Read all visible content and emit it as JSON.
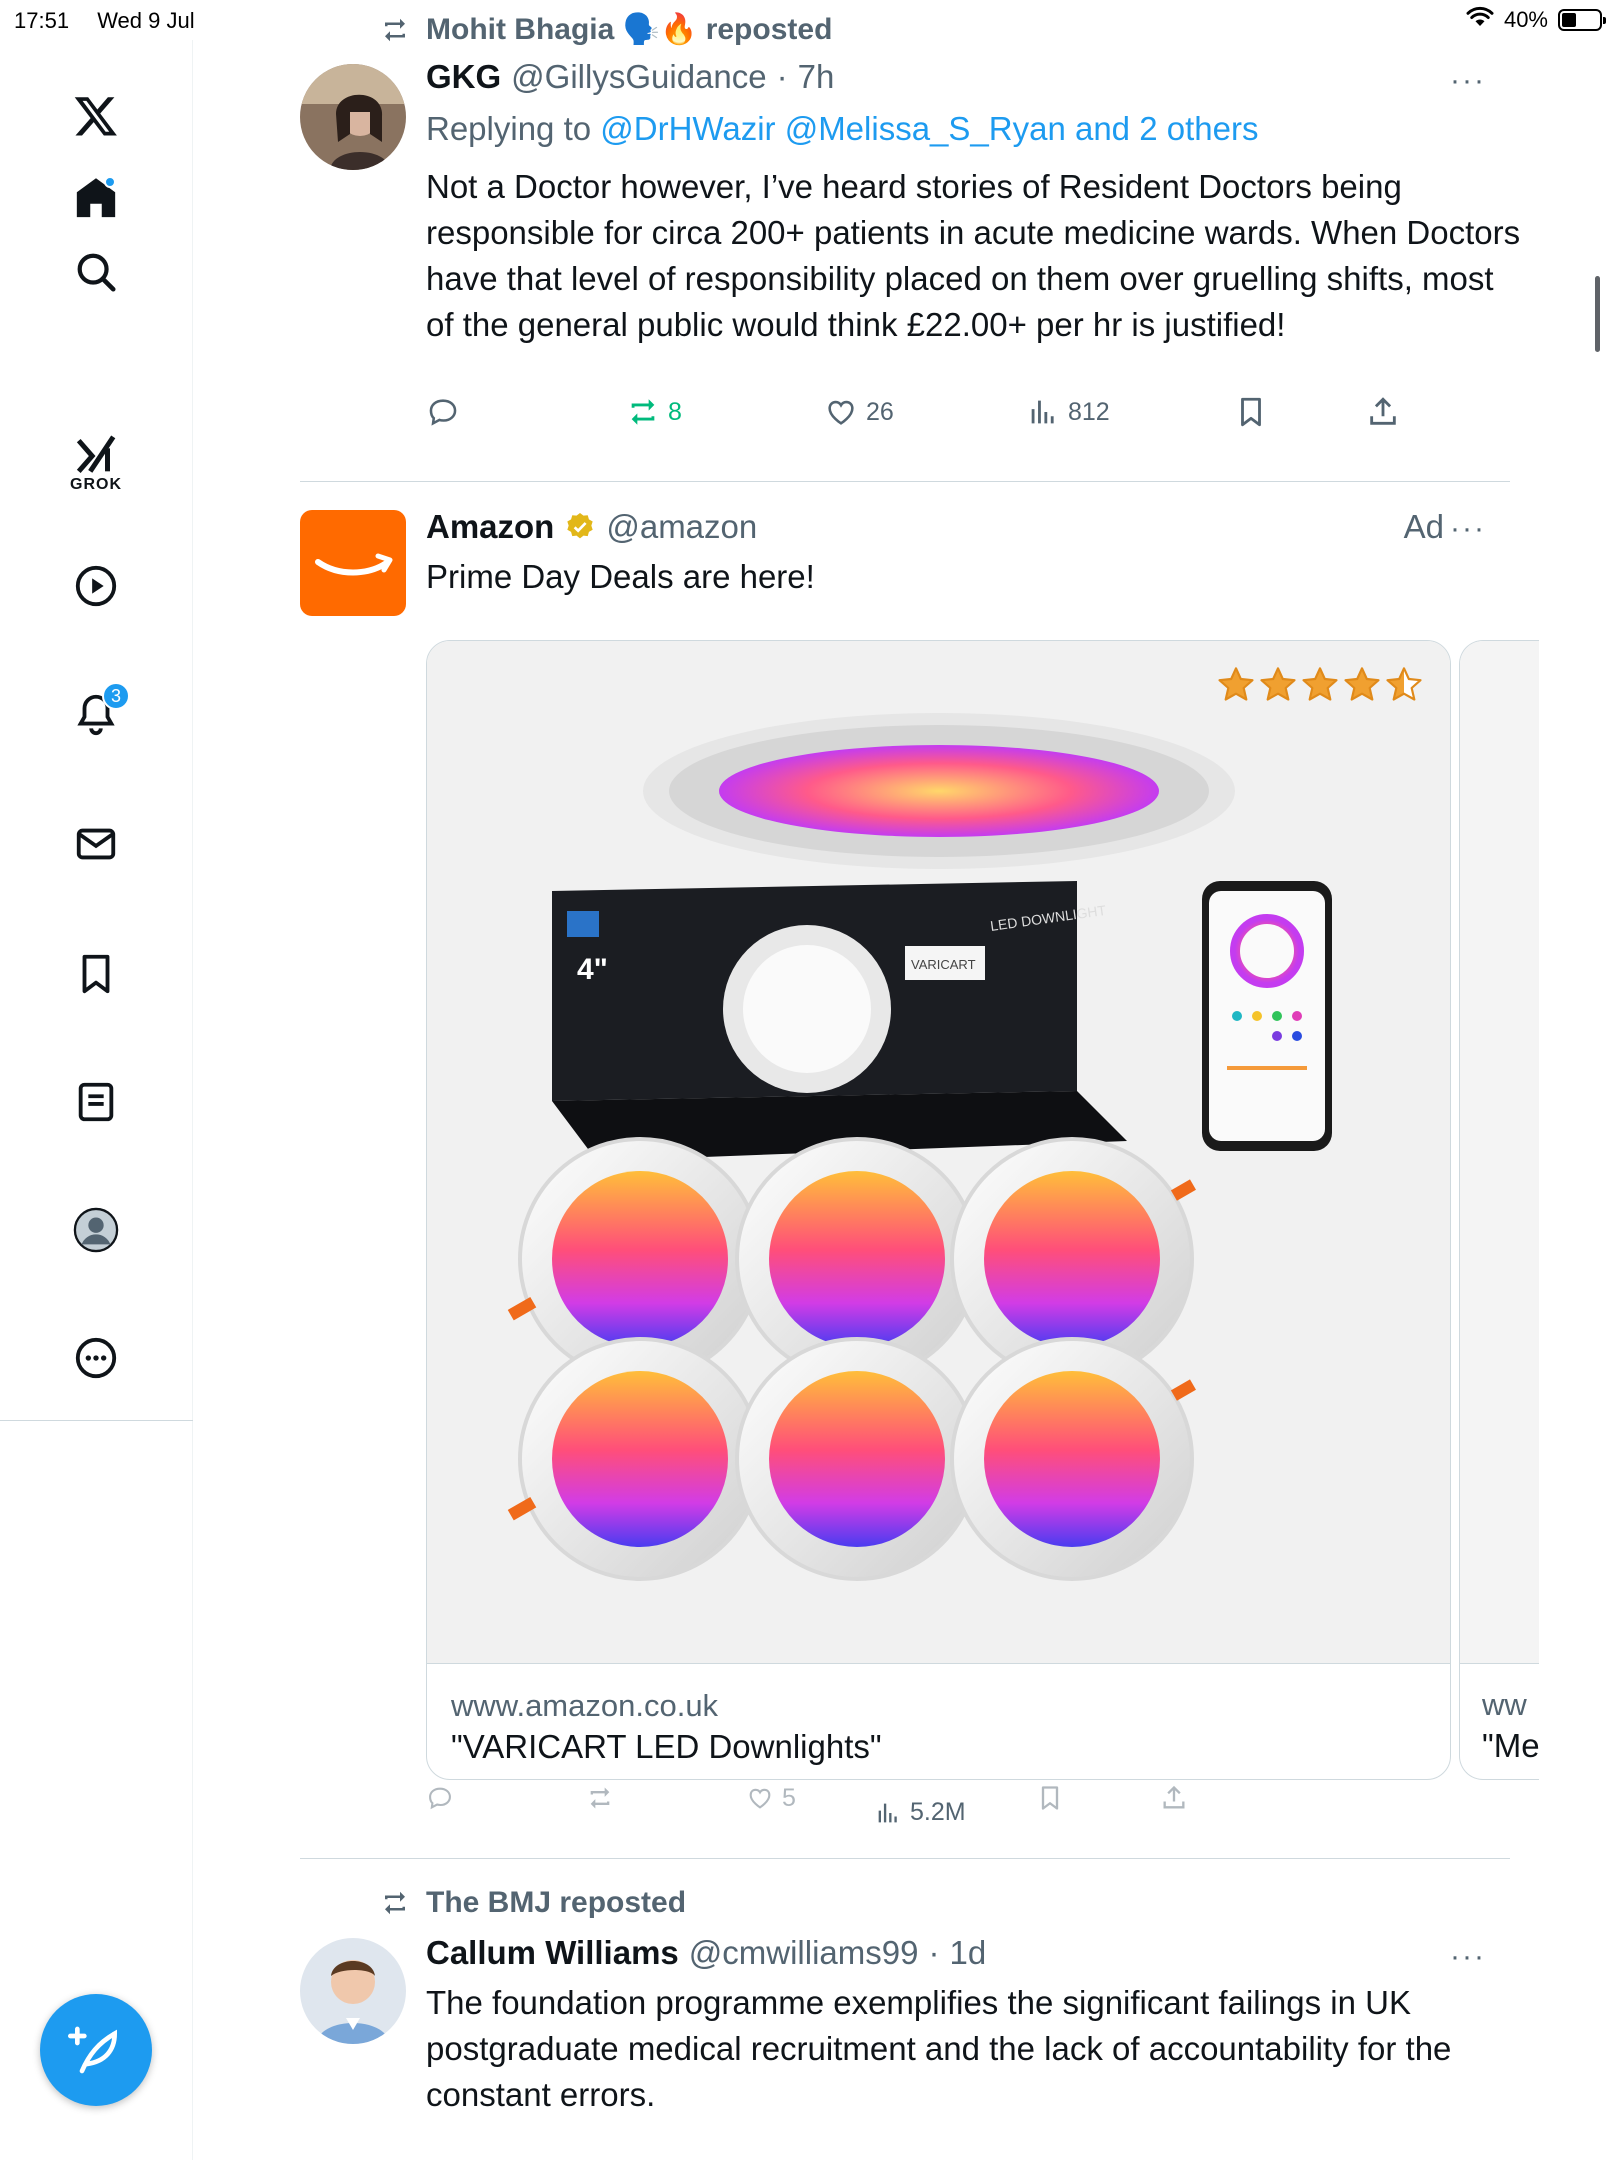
{
  "status_bar": {
    "time": "17:51",
    "date": "Wed 9 Jul",
    "battery": "40%",
    "battery_level": 0.4
  },
  "sidebar": {
    "items": [
      {
        "name": "x-logo",
        "label": ""
      },
      {
        "name": "home",
        "label": ""
      },
      {
        "name": "search",
        "label": ""
      },
      {
        "name": "grok",
        "label": "GROK"
      },
      {
        "name": "videos",
        "label": ""
      },
      {
        "name": "notifications",
        "label": "",
        "badge": "3"
      },
      {
        "name": "messages",
        "label": ""
      },
      {
        "name": "bookmarks",
        "label": ""
      },
      {
        "name": "lists",
        "label": ""
      },
      {
        "name": "profile",
        "label": ""
      },
      {
        "name": "more",
        "label": ""
      }
    ]
  },
  "posts": [
    {
      "social_context": "Mohit Bhagia 🗣️🔥 reposted",
      "name": "GKG",
      "handle": "@GillysGuidance",
      "time": "7h",
      "replying_prefix": "Replying to",
      "replying_to": "@DrHWazir @Melissa_S_Ryan and 2 others",
      "text": "Not a Doctor however, I’ve heard stories of Resident Doctors being responsible for circa 200+ patients in acute medicine wards. When Doctors have that level of responsibility placed on them over gruelling shifts, most of the general public would think £22.00+ per hr is justified!",
      "reposts": "8",
      "likes": "26",
      "views": "812"
    },
    {
      "name": "Amazon",
      "handle": "@amazon",
      "ad_label": "Ad",
      "text": "Prime Day Deals are here!",
      "card": {
        "domain": "www.amazon.co.uk",
        "title": "\"VARICART LED Downlights\"",
        "rating": 4.5,
        "box_size_label": "4\"",
        "box_brand": "VARICART",
        "box_side": "LED DOWNLIGHT"
      },
      "card_next": {
        "domain": "ww",
        "title": "\"Me"
      },
      "likes": "5",
      "views": "5.2M"
    },
    {
      "social_context": "The BMJ reposted",
      "name": "Callum Williams",
      "handle": "@cmwilliams99",
      "time": "1d",
      "text": "The foundation programme exemplifies the significant failings in UK postgraduate medical recruitment and the lack of accountability for the constant errors."
    }
  ],
  "colors": {
    "accent": "#1d9bf0",
    "repost_green": "#00ba7c",
    "secondary_text": "#536471",
    "amazon_orange": "#ff6a00"
  }
}
